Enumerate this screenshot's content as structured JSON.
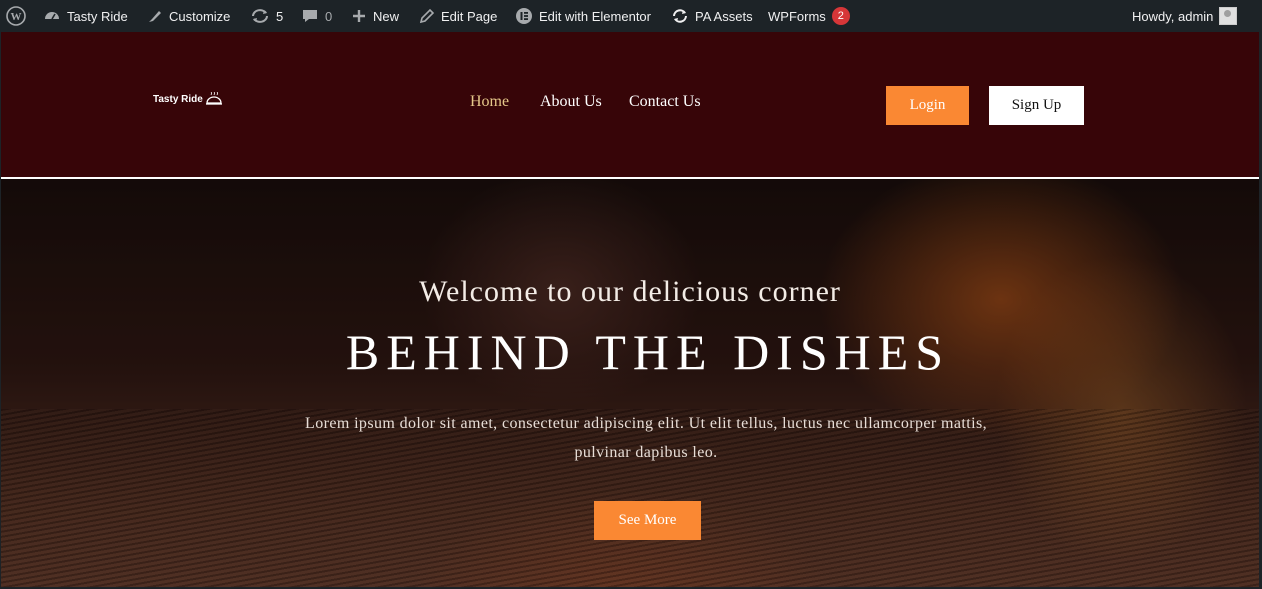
{
  "adminbar": {
    "site_name": "Tasty Ride",
    "customize": "Customize",
    "updates_count": "5",
    "comments_count": "0",
    "new_label": "New",
    "edit_page": "Edit Page",
    "elementor": "Edit with Elementor",
    "pa_assets": "PA Assets",
    "wpforms": "WPForms",
    "wpforms_count": "2",
    "howdy": "Howdy, admin"
  },
  "header": {
    "logo_text": "Tasty Ride",
    "nav": [
      "Home",
      "About Us",
      "Contact Us"
    ],
    "login": "Login",
    "signup": "Sign Up"
  },
  "hero": {
    "subtitle": "Welcome to our delicious corner",
    "title": "BEHIND THE DISHES",
    "text": "Lorem ipsum dolor sit amet, consectetur adipiscing elit. Ut elit tellus, luctus nec ullamcorper mattis, pulvinar dapibus leo.",
    "button": "See More"
  },
  "colors": {
    "accent": "#fa8833",
    "header_bg": "#370508",
    "adminbar_bg": "#1d2327",
    "nav_active": "#e6c88a"
  }
}
